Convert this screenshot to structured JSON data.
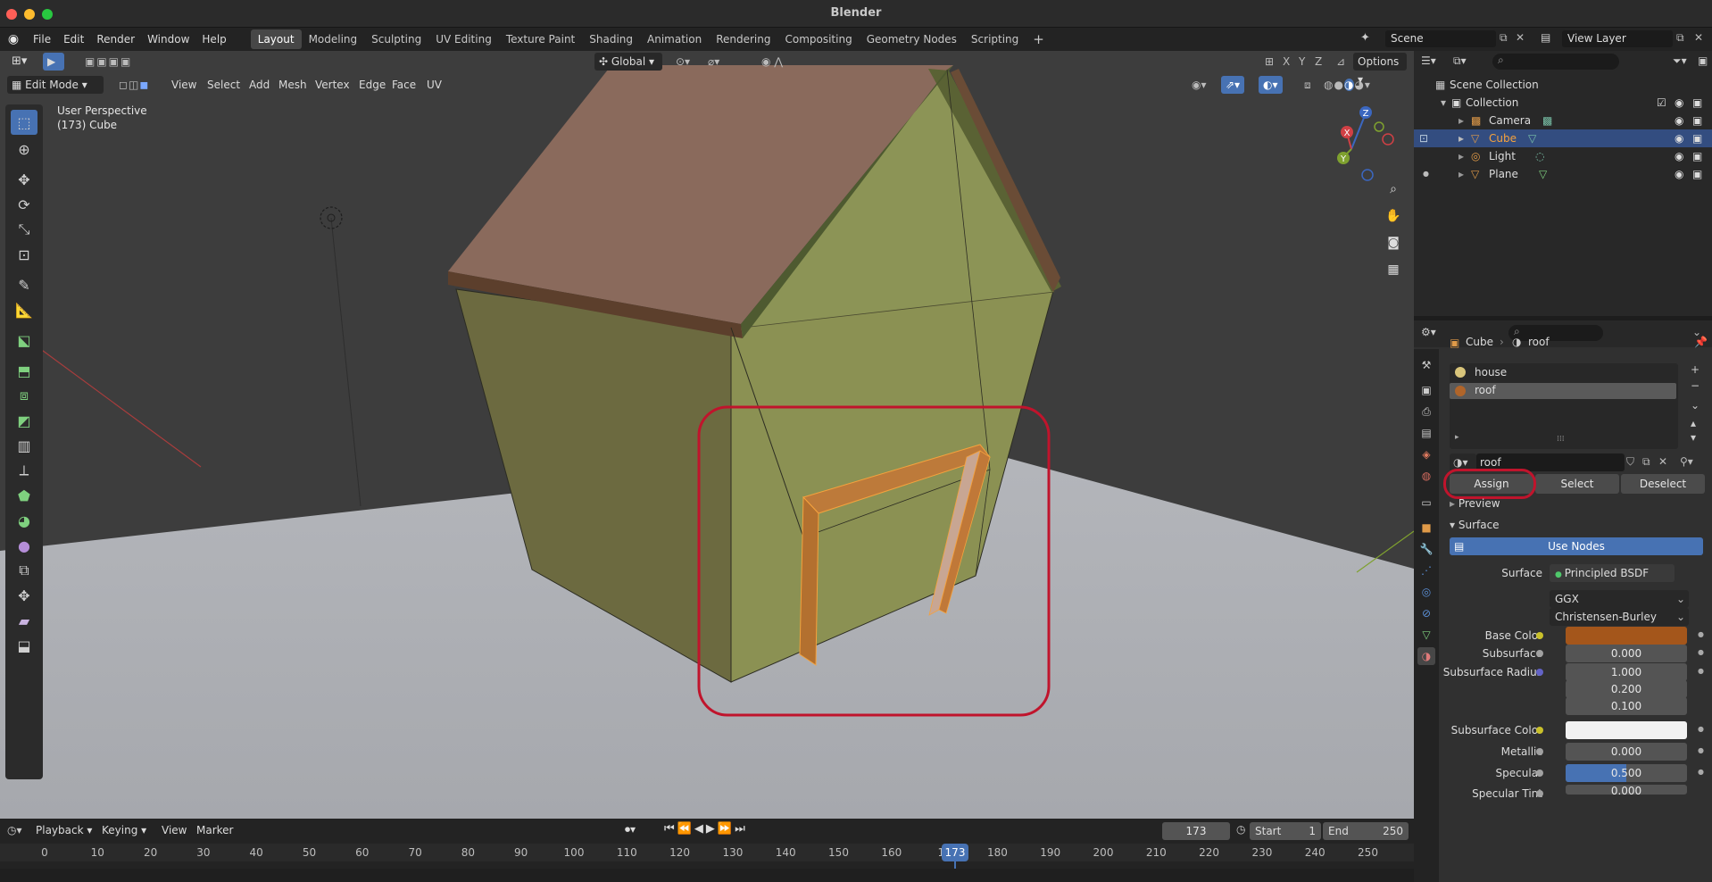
{
  "app": {
    "title": "Blender"
  },
  "menu": {
    "items": [
      "File",
      "Edit",
      "Render",
      "Window",
      "Help"
    ]
  },
  "workspaces": [
    "Layout",
    "Modeling",
    "Sculpting",
    "UV Editing",
    "Texture Paint",
    "Shading",
    "Animation",
    "Rendering",
    "Compositing",
    "Geometry Nodes",
    "Scripting"
  ],
  "workspace_active": "Layout",
  "scene": {
    "name": "Scene",
    "view_layer": "View Layer"
  },
  "viewport": {
    "mode": "Edit Mode",
    "menus": [
      "View",
      "Select",
      "Add",
      "Mesh",
      "Vertex",
      "Edge",
      "Face",
      "UV"
    ],
    "orientation": "Global",
    "options_label": "Options",
    "overlay_line1": "User Perspective",
    "overlay_line2": "(173) Cube",
    "axes": {
      "x": "X",
      "y": "Y",
      "z": "Z"
    },
    "gizmo": {
      "x": "X",
      "y": "Y",
      "z": "Z"
    }
  },
  "outliner": {
    "root": "Scene Collection",
    "collection": "Collection",
    "items": [
      {
        "name": "Camera",
        "selected": false
      },
      {
        "name": "Cube",
        "selected": true
      },
      {
        "name": "Light",
        "selected": false
      },
      {
        "name": "Plane",
        "selected": false
      }
    ]
  },
  "properties": {
    "breadcrumb_object": "Cube",
    "breadcrumb_material": "roof",
    "slots": [
      {
        "name": "house",
        "selected": false,
        "color": "#d8c47a"
      },
      {
        "name": "roof",
        "selected": true,
        "color": "#b0652a"
      }
    ],
    "material_name": "roof",
    "assign_label": "Assign",
    "select_label": "Select",
    "deselect_label": "Deselect",
    "preview_label": "Preview",
    "surface_panel_label": "Surface",
    "use_nodes_label": "Use Nodes",
    "surface_label": "Surface",
    "surface_value": "Principled BSDF",
    "distribution": "GGX",
    "subsurface_method": "Christensen-Burley",
    "base_color_label": "Base Color",
    "base_color": "#a4561b",
    "subsurface_label": "Subsurface",
    "subsurface_value": "0.000",
    "subsurface_radius_label": "Subsurface Radius",
    "subsurface_radius": [
      "1.000",
      "0.200",
      "0.100"
    ],
    "subsurface_color_label": "Subsurface Color",
    "subsurface_color": "#f2f2f2",
    "metallic_label": "Metallic",
    "metallic_value": "0.000",
    "specular_label": "Specular",
    "specular_value": "0.500",
    "specular_fraction": 0.5,
    "specular_tint_label": "Specular Tint",
    "specular_tint_value": "0.000"
  },
  "timeline": {
    "menus": [
      "Playback",
      "Keying",
      "View",
      "Marker"
    ],
    "current_frame": "173",
    "start_label": "Start",
    "start": "1",
    "end_label": "End",
    "end": "250",
    "ticks": [
      "0",
      "10",
      "20",
      "30",
      "40",
      "50",
      "60",
      "70",
      "80",
      "90",
      "100",
      "110",
      "120",
      "130",
      "140",
      "150",
      "160",
      "17",
      "180",
      "190",
      "200",
      "210",
      "220",
      "230",
      "240",
      "250"
    ],
    "playhead": "173"
  },
  "colors": {
    "accent": "#4772b3",
    "highlight_ring": "#c0142c",
    "active_object": "#f5a23d"
  }
}
